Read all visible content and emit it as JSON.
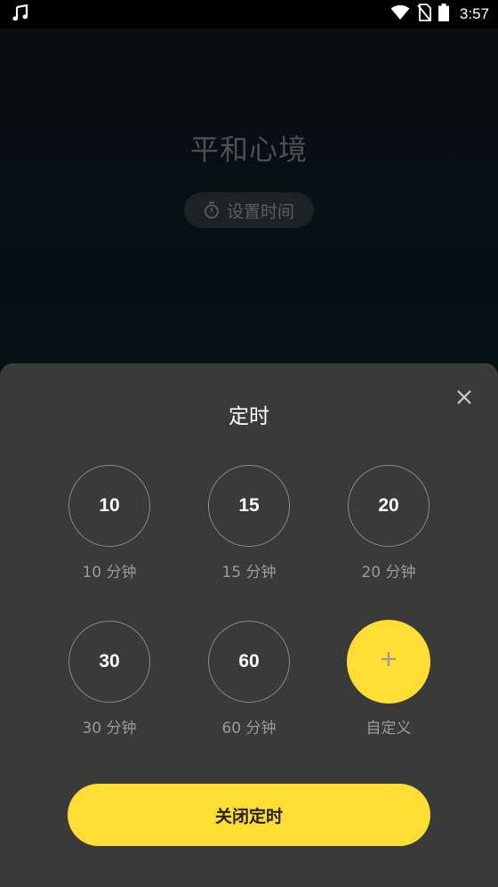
{
  "status_bar": {
    "time": "3:57",
    "icons": [
      "music-note-icon",
      "wifi-icon",
      "no-sim-icon",
      "battery-icon"
    ]
  },
  "background": {
    "title": "平和心境",
    "timer_pill_label": "设置时间",
    "timer_icon": "stopwatch-icon"
  },
  "sheet": {
    "title": "定时",
    "close_icon": "close-icon",
    "options": [
      {
        "value": "10",
        "label": "10 分钟"
      },
      {
        "value": "15",
        "label": "15 分钟"
      },
      {
        "value": "20",
        "label": "20 分钟"
      },
      {
        "value": "30",
        "label": "30 分钟"
      },
      {
        "value": "60",
        "label": "60 分钟"
      }
    ],
    "custom": {
      "icon": "plus-icon",
      "label": "自定义"
    },
    "off_button_label": "关闭定时"
  },
  "colors": {
    "accent": "#fedd34",
    "sheet_bg": "#3a3a3a",
    "muted_text": "#9a9a9a"
  }
}
